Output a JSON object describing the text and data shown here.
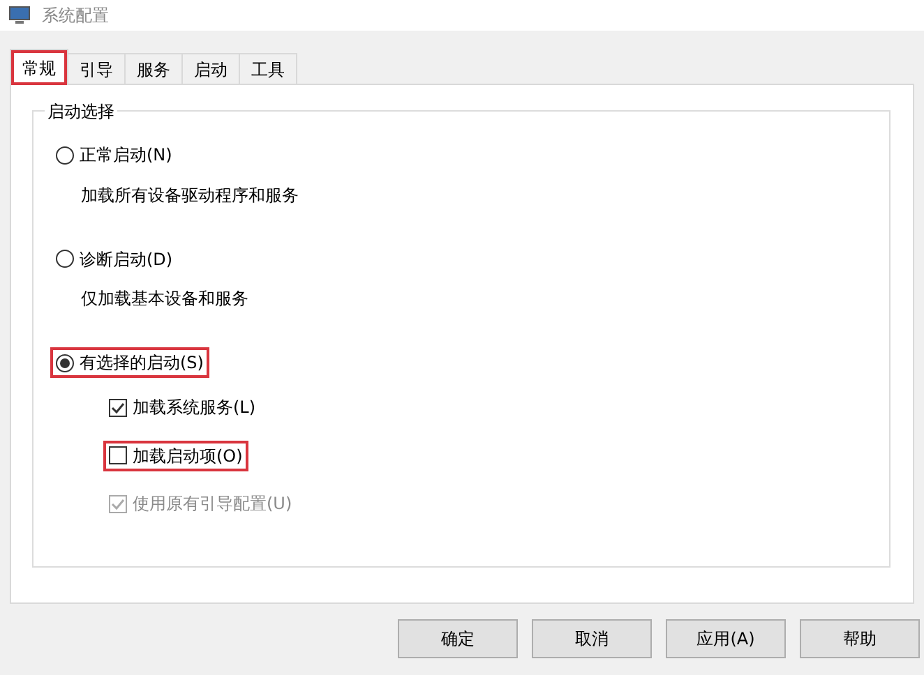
{
  "window": {
    "title": "系统配置"
  },
  "tabs": [
    {
      "label": "常规",
      "selected": true,
      "highlighted": true
    },
    {
      "label": "引导",
      "selected": false,
      "highlighted": false
    },
    {
      "label": "服务",
      "selected": false,
      "highlighted": false
    },
    {
      "label": "启动",
      "selected": false,
      "highlighted": false
    },
    {
      "label": "工具",
      "selected": false,
      "highlighted": false
    }
  ],
  "group": {
    "title": "启动选择",
    "options": [
      {
        "kind": "radio",
        "label": "正常启动(N)",
        "selected": false,
        "highlighted": false,
        "description": "加载所有设备驱动程序和服务"
      },
      {
        "kind": "radio",
        "label": "诊断启动(D)",
        "selected": false,
        "highlighted": false,
        "description": "仅加载基本设备和服务"
      },
      {
        "kind": "radio",
        "label": "有选择的启动(S)",
        "selected": true,
        "highlighted": true
      },
      {
        "kind": "checkbox",
        "label": "加载系统服务(L)",
        "checked": true,
        "disabled": false,
        "highlighted": false
      },
      {
        "kind": "checkbox",
        "label": "加载启动项(O)",
        "checked": false,
        "disabled": false,
        "highlighted": true
      },
      {
        "kind": "checkbox",
        "label": "使用原有引导配置(U)",
        "checked": true,
        "disabled": true,
        "highlighted": false
      }
    ]
  },
  "buttons": [
    "确定",
    "取消",
    "应用(A)",
    "帮助"
  ]
}
